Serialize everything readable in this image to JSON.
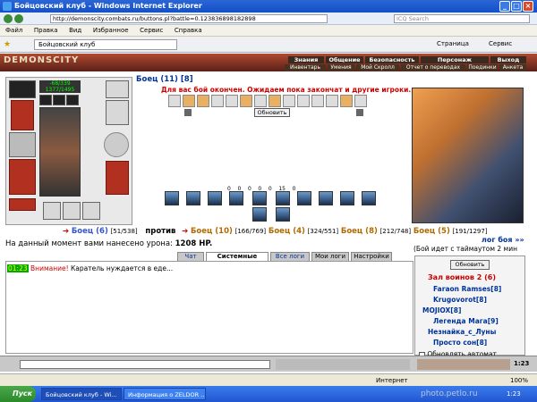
{
  "window": {
    "title": "Бойцовский клуб - Windows Internet Explorer"
  },
  "address": {
    "url": "http://demonscity.combats.ru/buttons.pl?battle=0.123836898182898",
    "search_placeholder": "ICQ Search"
  },
  "menu": [
    "Файл",
    "Правка",
    "Вид",
    "Избранное",
    "Сервис",
    "Справка"
  ],
  "tab": {
    "title": "Бойцовский клуб"
  },
  "toolbar_right": [
    "Страница",
    "Сервис"
  ],
  "game": {
    "logo": "DEMONSCITY",
    "nav_top": [
      "Знания",
      "Общение",
      "Безопасность",
      "Персонаж",
      "Выход"
    ],
    "nav_sub": [
      "Инвентарь",
      "Умения",
      "Мой Скролл",
      "Отчет о переводах",
      "Поединки",
      "Анкета"
    ],
    "hp": "-68/339",
    "mana": "1377/1495",
    "fighter": "Боец (11) [8]",
    "wait_msg": "Для вас бой окончен. Ожидаем пока закончат и другие игроки...",
    "refresh": "Обновить",
    "stats": [
      "0",
      "0",
      "0",
      "0",
      "0",
      "15",
      "0"
    ],
    "versus": {
      "left": "Боец (6)",
      "left_hp": "[51/538]",
      "vs": "против",
      "right": [
        {
          "name": "Боец (10)",
          "hp": "[166/769]"
        },
        {
          "name": "Боец (4)",
          "hp": "[324/551]"
        },
        {
          "name": "Боец (8)",
          "hp": "[212/748]"
        },
        {
          "name": "Боец (5)",
          "hp": "[191/1297]"
        }
      ]
    },
    "damage_label": "На данный момент вами нанесено урона:",
    "damage_value": "1208 HP.",
    "log_link": "лог боя »»",
    "timeout": "(Бой идет с таймаутом 2 мин",
    "tabs": [
      "Чат",
      "Системные сообщения",
      "Все логи",
      "Мои логи",
      "Настройки"
    ],
    "chat": {
      "time": "01:23",
      "warn": "Внимание!",
      "text": "Каратель нуждается в еде..."
    },
    "userlist": {
      "refresh": "Обновить",
      "room": "Зал воинов 2 (6)",
      "users": [
        "Faraon Ramses[8]",
        "Krugovorot[8]",
        "МОJIOX[8]",
        "Легенда Мага[9]",
        "Незнайка_с_Луны",
        "Просто сон[8]"
      ],
      "auto": "Обновлять автомат."
    },
    "clock": "1:23"
  },
  "status": {
    "zone": "Интернет",
    "zoom": "100%"
  },
  "taskbar": {
    "start": "Пуск",
    "items": [
      "Бойцовский клуб - Wi...",
      "Информация о ZELDOR ..."
    ],
    "clock": "1:23"
  },
  "watermark": "photo.petlo.ru"
}
